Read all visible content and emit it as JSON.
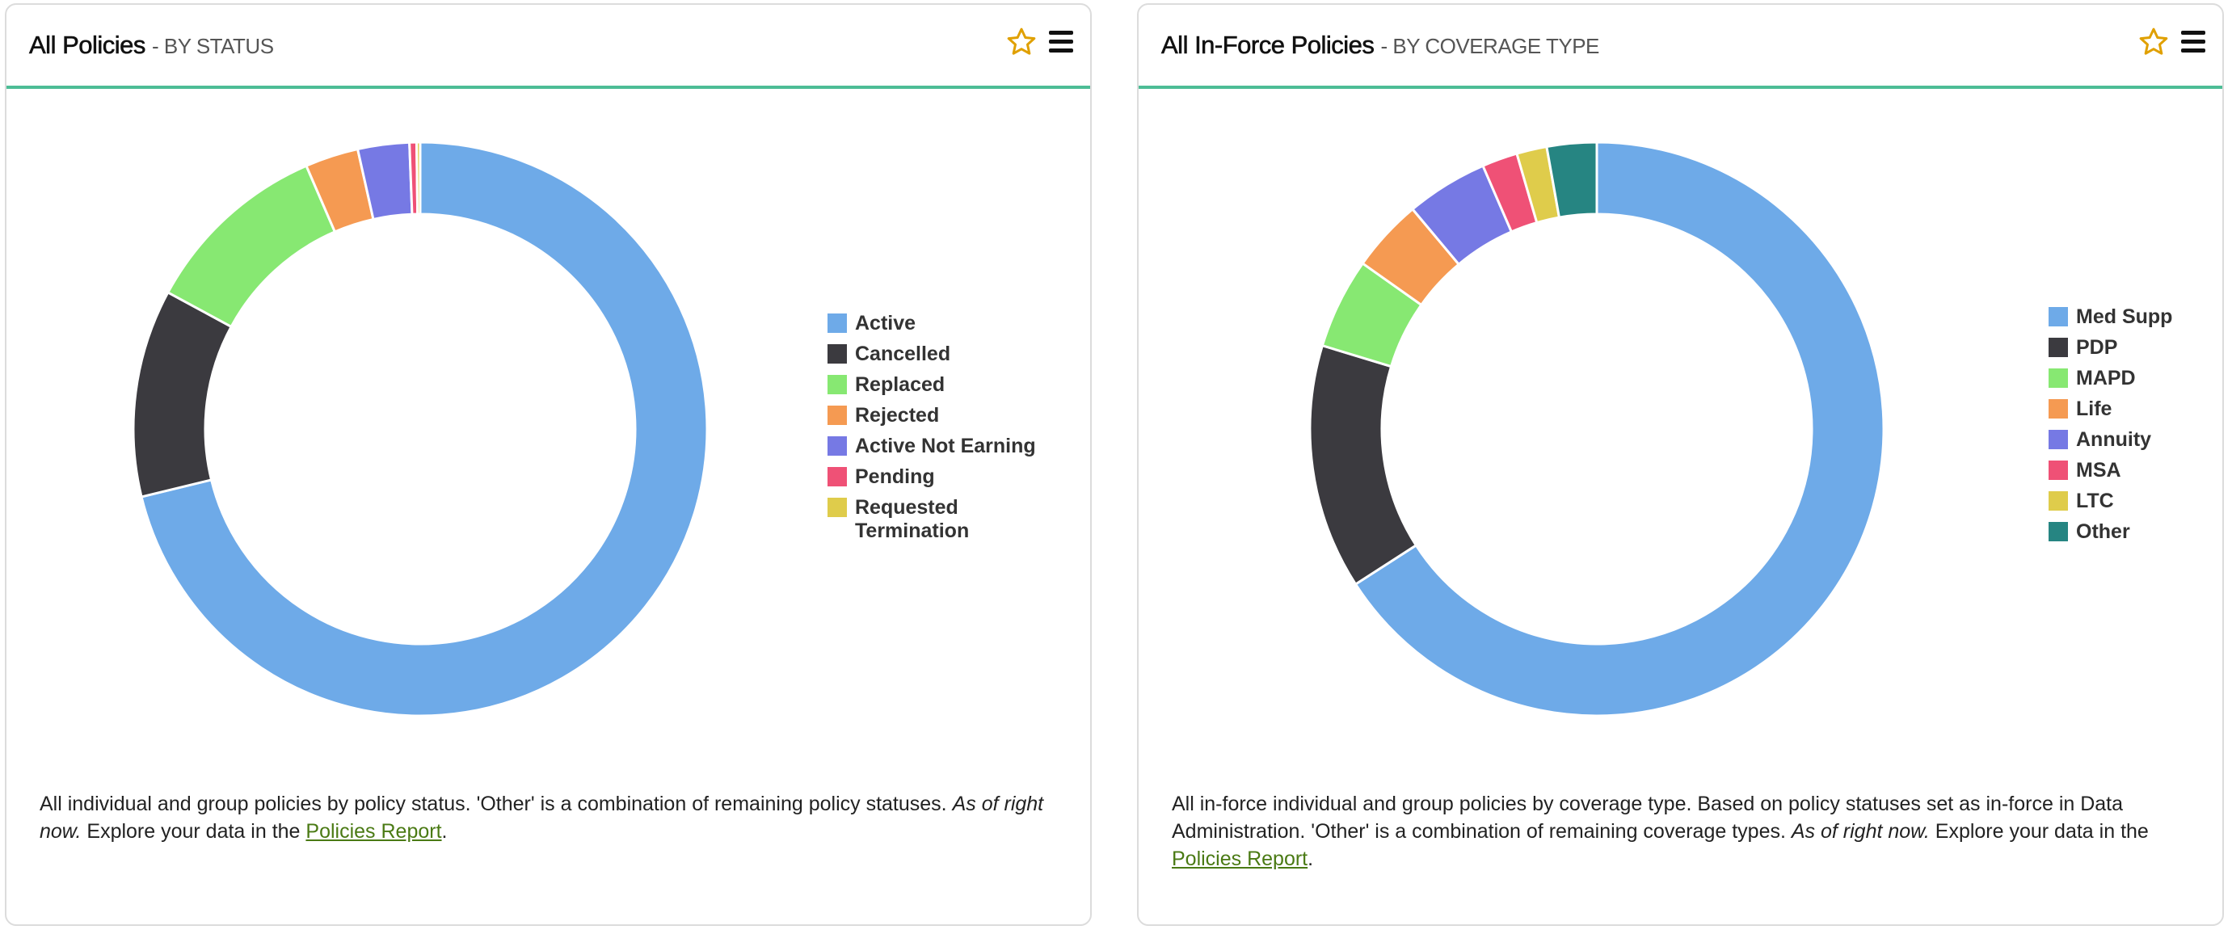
{
  "panels": [
    {
      "title": "All Policies",
      "subtitle": "- BY STATUS",
      "favorite_icon": "star-outline-icon",
      "menu_icon": "hamburger-menu-icon",
      "description": {
        "text1": "All individual and group policies by policy status. 'Other' is a combination of remaining policy statuses.",
        "italic": "As of right now.",
        "text2": "Explore your data in the",
        "link": "Policies Report",
        "end": "."
      }
    },
    {
      "title": "All In-Force Policies",
      "subtitle": "- BY COVERAGE TYPE",
      "favorite_icon": "star-outline-icon",
      "menu_icon": "hamburger-menu-icon",
      "description": {
        "text1": "All in-force individual and group policies by coverage type. Based on policy statuses set as in-force in Data Administration. 'Other' is a combination of remaining coverage types.",
        "italic": "As of right now.",
        "text2": "Explore your data in the",
        "link": "Policies Report",
        "end": "."
      }
    }
  ],
  "colors": {
    "accent_line": "#4dbd96",
    "star": "#e0a000",
    "link": "#4a7a14"
  },
  "chart_data": [
    {
      "type": "pie",
      "variant": "donut",
      "title": "All Policies - BY STATUS",
      "legend_position": "right",
      "categories": [
        "Active",
        "Cancelled",
        "Replaced",
        "Rejected",
        "Active Not Earning",
        "Pending",
        "Requested Termination"
      ],
      "values_percent": [
        71.2,
        11.7,
        10.6,
        3.0,
        2.9,
        0.4,
        0.2
      ],
      "colors": [
        "#6eaae8",
        "#3b3a3f",
        "#87e872",
        "#f59a52",
        "#7679e4",
        "#ef5176",
        "#dfcc4b"
      ]
    },
    {
      "type": "pie",
      "variant": "donut",
      "title": "All In-Force Policies - BY COVERAGE TYPE",
      "legend_position": "right",
      "categories": [
        "Med Supp",
        "PDP",
        "MAPD",
        "Life",
        "Annuity",
        "MSA",
        "LTC",
        "Other"
      ],
      "values_percent": [
        65.9,
        13.8,
        5.1,
        4.1,
        4.6,
        2.0,
        1.7,
        2.8
      ],
      "colors": [
        "#6eaae8",
        "#3b3a3f",
        "#87e872",
        "#f59a52",
        "#7679e4",
        "#ef5176",
        "#dfcc4b",
        "#268582"
      ]
    }
  ]
}
